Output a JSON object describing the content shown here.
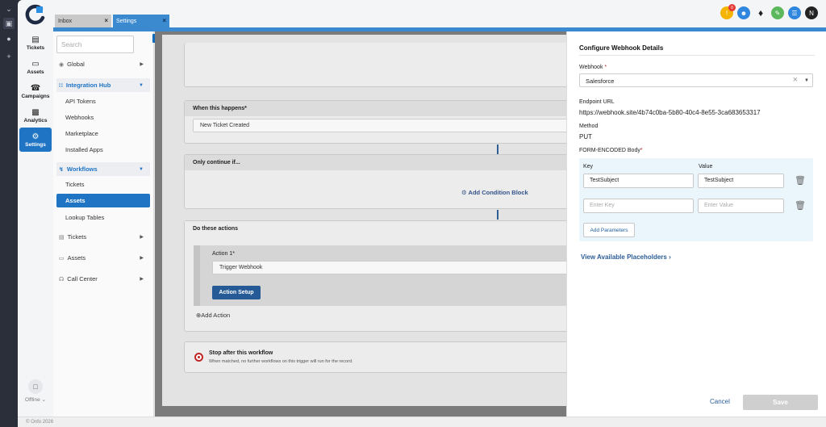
{
  "app": {
    "nav": [
      {
        "label": "Tickets",
        "icon": "inbox-icon"
      },
      {
        "label": "Assets",
        "icon": "monitor-icon"
      },
      {
        "label": "Campaigns",
        "icon": "megaphone-icon"
      },
      {
        "label": "Analytics",
        "icon": "bar-chart-icon"
      },
      {
        "label": "Settings",
        "icon": "gear-icon"
      }
    ],
    "offline_label": "Offline ⌄",
    "footer": "© Onfo 2026",
    "accent": "#3b8ad0",
    "brand_blue": "#1f74c4"
  },
  "tabs": [
    {
      "label": "Inbox",
      "close": "×"
    },
    {
      "label": "Settings",
      "close": "×"
    }
  ],
  "top_icons": {
    "notifications_badge": "0",
    "avatar_initial": "N"
  },
  "menu": {
    "search_placeholder": "Search",
    "items": [
      {
        "label": "Global",
        "type": "item"
      },
      {
        "label": "Integration Hub",
        "type": "group"
      },
      {
        "label": "API Tokens",
        "type": "sub"
      },
      {
        "label": "Webhooks",
        "type": "sub"
      },
      {
        "label": "Marketplace",
        "type": "sub"
      },
      {
        "label": "Installed Apps",
        "type": "sub"
      },
      {
        "label": "Workflows",
        "type": "group"
      },
      {
        "label": "Tickets",
        "type": "sub"
      },
      {
        "label": "Assets",
        "type": "sub-active"
      },
      {
        "label": "Lookup Tables",
        "type": "sub"
      },
      {
        "label": "Tickets",
        "type": "item"
      },
      {
        "label": "Assets",
        "type": "item"
      },
      {
        "label": "Call Center",
        "type": "item"
      }
    ]
  },
  "workflow": {
    "trigger_header": "When this happens*",
    "trigger_value": "New Ticket Created",
    "condition_header": "Only continue if...",
    "add_condition": "Add Condition Block",
    "actions_header": "Do these actions",
    "action_label": "Action 1*",
    "action_value": "Trigger Webhook",
    "action_setup": "Action Setup",
    "add_action": "Add Action",
    "stop_title": "Stop after this workflow",
    "stop_sub": "When matched, no further workflows on this trigger will run for the record."
  },
  "panel": {
    "title": "Configure Webhook Details",
    "webhook_label": "Webhook",
    "webhook_value": "Salesforce",
    "endpoint_label": "Endpoint URL",
    "endpoint_value": "https://webhook.site/4b74c0ba-5b80-40c4-8e55-3ca683653317",
    "method_label": "Method",
    "method_value": "PUT",
    "body_label": "FORM-ENCODED Body",
    "key_header": "Key",
    "value_header": "Value",
    "row1_key": "TestSubject",
    "row1_value": "TestSubject",
    "key_placeholder": "Enter Key",
    "value_placeholder": "Enter Value",
    "add_params": "Add Parameters",
    "view_placeholders": "View Available Placeholders",
    "cancel": "Cancel",
    "save": "Save"
  }
}
